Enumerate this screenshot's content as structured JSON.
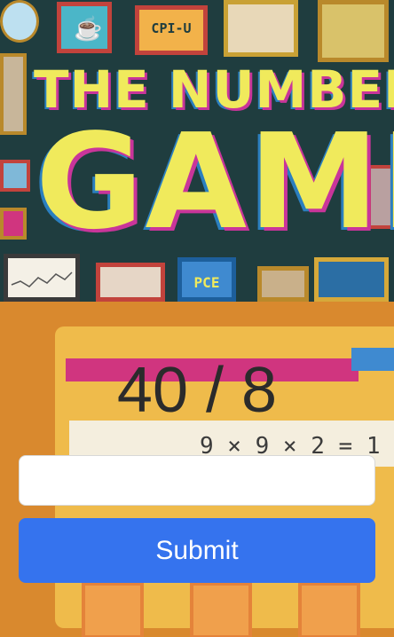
{
  "banner": {
    "title_line1": "THE NUMBERS",
    "title_line2": "GAME",
    "frame_labels": {
      "cpi_u": "CPI-U",
      "pce": "PCE"
    }
  },
  "game": {
    "score": "40 / 8",
    "equation_preview": "9 × 9 × 2  =  1",
    "answer_input": {
      "value": "",
      "placeholder": ""
    },
    "submit_label": "Submit"
  },
  "colors": {
    "banner_bg": "#1f3d3f",
    "title_yellow": "#f0ea5c",
    "accent_pink": "#c9359a",
    "accent_blue": "#2b7fbf",
    "game_bg": "#d9892e",
    "submit_button": "#3573ee"
  }
}
